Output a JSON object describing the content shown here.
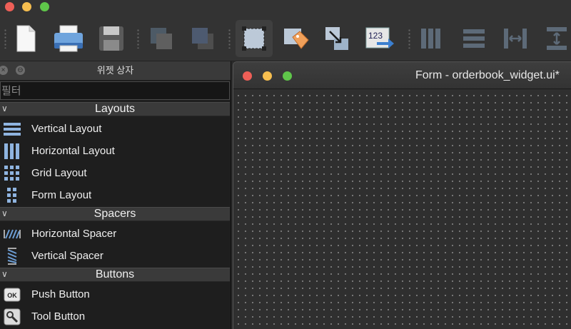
{
  "window": {
    "traffic_lights": [
      "close",
      "minimize",
      "zoom"
    ]
  },
  "toolbar": {
    "buttons": [
      {
        "name": "new-file-button",
        "icon": "new-file-icon"
      },
      {
        "name": "open-button",
        "icon": "printer-icon"
      },
      {
        "name": "save-button",
        "icon": "floppy-disk-icon"
      },
      {
        "name": "send-back-button",
        "icon": "send-backward-icon"
      },
      {
        "name": "bring-front-button",
        "icon": "bring-forward-icon"
      },
      {
        "name": "edit-widgets-button",
        "icon": "edit-widgets-icon",
        "active": true
      },
      {
        "name": "edit-buddies-button",
        "icon": "tag-icon"
      },
      {
        "name": "edit-signals-button",
        "icon": "signal-slot-icon"
      },
      {
        "name": "edit-tab-order-button",
        "icon": "tab-order-icon",
        "text": "123"
      },
      {
        "name": "layout-horizontal-button",
        "icon": "horizontal-layout-icon"
      },
      {
        "name": "layout-vertical-button",
        "icon": "vertical-layout-icon"
      },
      {
        "name": "layout-splitter-h-button",
        "icon": "horizontal-splitter-icon"
      },
      {
        "name": "layout-splitter-v-button",
        "icon": "vertical-splitter-icon"
      }
    ]
  },
  "widget_box": {
    "title": "위젯 상자",
    "close_glyph": "×",
    "float_glyph": "⊖",
    "filter_placeholder": "필터",
    "categories": [
      {
        "label": "Layouts",
        "items": [
          {
            "label": "Vertical Layout",
            "icon": "vertical-layout-icon"
          },
          {
            "label": "Horizontal Layout",
            "icon": "horizontal-layout-icon"
          },
          {
            "label": "Grid Layout",
            "icon": "grid-layout-icon"
          },
          {
            "label": "Form Layout",
            "icon": "form-layout-icon"
          }
        ]
      },
      {
        "label": "Spacers",
        "items": [
          {
            "label": "Horizontal Spacer",
            "icon": "horizontal-spacer-icon"
          },
          {
            "label": "Vertical Spacer",
            "icon": "vertical-spacer-icon"
          }
        ]
      },
      {
        "label": "Buttons",
        "items": [
          {
            "label": "Push Button",
            "icon": "push-button-icon",
            "icon_text": "OK"
          },
          {
            "label": "Tool Button",
            "icon": "tool-button-icon"
          }
        ]
      }
    ]
  },
  "form_window": {
    "title": "Form - orderbook_widget.ui*"
  },
  "colors": {
    "close": "#ee5f57",
    "minimize": "#f6be4f",
    "zoom": "#5fc64a",
    "canvas": "#2f2f2f",
    "grid_dot": "#8a8a8a"
  }
}
